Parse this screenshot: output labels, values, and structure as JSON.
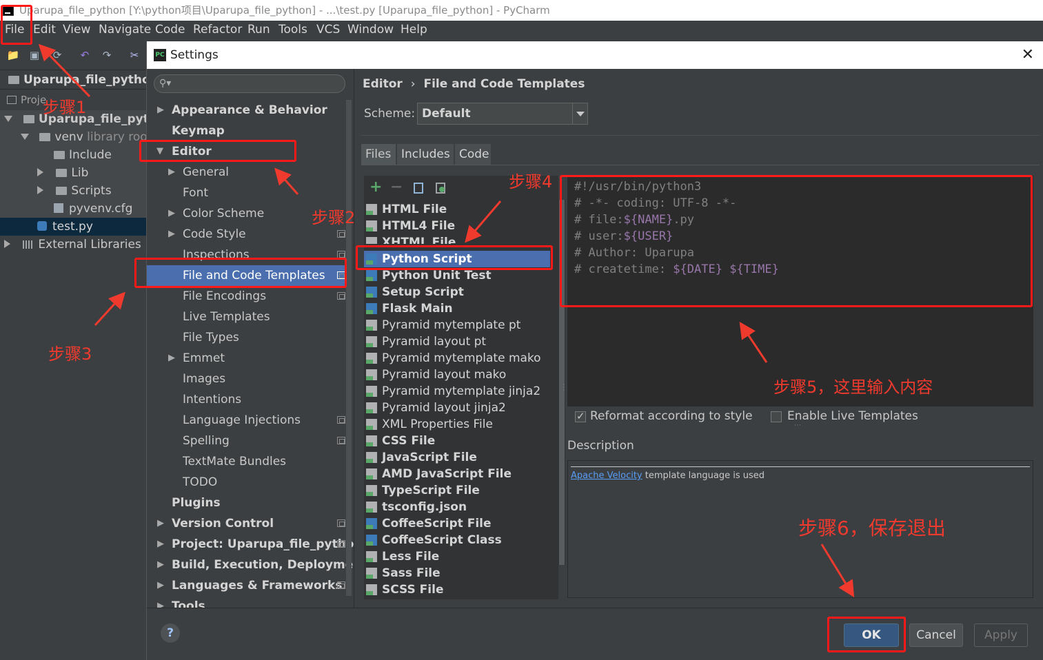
{
  "window": {
    "title": "Uparupa_file_python [Y:\\python项目\\Uparupa_file_python] - ...\\test.py [Uparupa_file_python] - PyCharm"
  },
  "menubar": [
    "File",
    "Edit",
    "View",
    "Navigate",
    "Code",
    "Refactor",
    "Run",
    "Tools",
    "VCS",
    "Window",
    "Help"
  ],
  "project_panel": {
    "header": "Uparupa_file_python",
    "tab_label": "Proje",
    "tree": [
      {
        "label": "Uparupa_file_pytho"
      },
      {
        "label": "venv"
      },
      {
        "label": "library root"
      },
      {
        "label": "Include"
      },
      {
        "label": "Lib"
      },
      {
        "label": "Scripts"
      },
      {
        "label": "pyvenv.cfg"
      },
      {
        "label": "test.py"
      },
      {
        "label": "External Libraries"
      }
    ]
  },
  "dialog": {
    "title": "Settings",
    "search_placeholder": "",
    "tree": [
      {
        "label": "Appearance & Behavior"
      },
      {
        "label": "Keymap"
      },
      {
        "label": "Editor"
      },
      {
        "label": "General"
      },
      {
        "label": "Font"
      },
      {
        "label": "Color Scheme"
      },
      {
        "label": "Code Style"
      },
      {
        "label": "Inspections"
      },
      {
        "label": "File and Code Templates"
      },
      {
        "label": "File Encodings"
      },
      {
        "label": "Live Templates"
      },
      {
        "label": "File Types"
      },
      {
        "label": "Emmet"
      },
      {
        "label": "Images"
      },
      {
        "label": "Intentions"
      },
      {
        "label": "Language Injections"
      },
      {
        "label": "Spelling"
      },
      {
        "label": "TextMate Bundles"
      },
      {
        "label": "TODO"
      },
      {
        "label": "Plugins"
      },
      {
        "label": "Version Control"
      },
      {
        "label": "Project: Uparupa_file_pythoı"
      },
      {
        "label": "Build, Execution, Deployment"
      },
      {
        "label": "Languages & Frameworks"
      },
      {
        "label": "Tools"
      }
    ],
    "breadcrumb": {
      "root": "Editor",
      "sep": "›",
      "page": "File and Code Templates"
    },
    "scheme": {
      "label": "Scheme:",
      "value": "Default"
    },
    "tabs": [
      "Files",
      "Includes",
      "Code"
    ],
    "templates": [
      "HTML File",
      "HTML4 File",
      "XHTML File",
      "Python Script",
      "Python Unit Test",
      "Setup Script",
      "Flask Main",
      "Pyramid mytemplate pt",
      "Pyramid layout pt",
      "Pyramid mytemplate mako",
      "Pyramid layout mako",
      "Pyramid mytemplate jinja2",
      "Pyramid layout jinja2",
      "XML Properties File",
      "CSS File",
      "JavaScript File",
      "AMD JavaScript File",
      "TypeScript File",
      "tsconfig.json",
      "CoffeeScript File",
      "CoffeeScript Class",
      "Less File",
      "Sass File",
      "SCSS File"
    ],
    "editor": {
      "l1": "#!/usr/bin/python3",
      "l2": "# -*- coding: UTF-8 -*-",
      "l3a": "# file:",
      "l3v": "${NAME}",
      "l3b": ".py",
      "l4a": "# user:",
      "l4v": "${USER}",
      "l5": "# Author: Uparupa",
      "l6a": "# createtime: ",
      "l6v1": "${DATE}",
      "l6sp": " ",
      "l6v2": "${TIME}"
    },
    "options": {
      "reformat": {
        "label": "Reformat according to style",
        "checked": true
      },
      "live": {
        "label": "Enable Live Templates",
        "checked": false
      }
    },
    "description": {
      "label": "Description",
      "link": "Apache Velocity",
      "text": " template language is used"
    },
    "buttons": {
      "ok": "OK",
      "cancel": "Cancel",
      "apply": "Apply",
      "help": "?"
    }
  },
  "annotations": {
    "step1": "步骤1",
    "step2": "步骤2",
    "step3": "步骤3",
    "step4": "步骤4",
    "step5": "步骤5，这里输入内容",
    "step6": "步骤6，保存退出"
  },
  "colors": {
    "annotation": "#f03a2e",
    "selection": "#4b6eaf",
    "accent_button": "#365880"
  }
}
